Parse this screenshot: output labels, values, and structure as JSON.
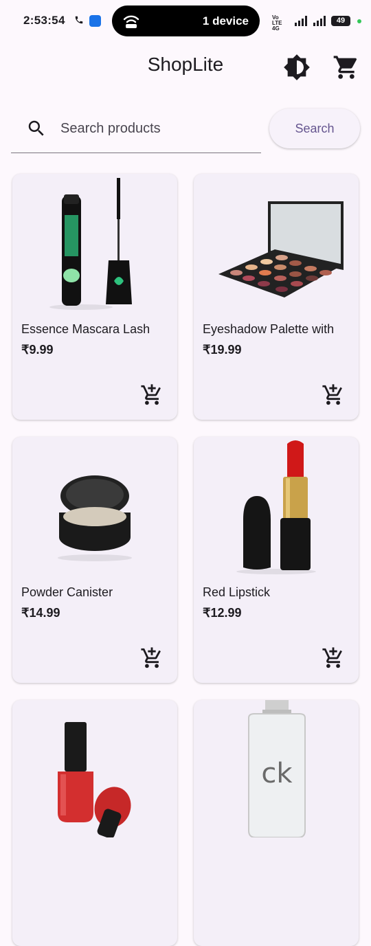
{
  "status_bar": {
    "time": "2:53:54",
    "device_pill": "1 device",
    "network": "Vo LTE 4G",
    "battery": "49"
  },
  "app_bar": {
    "title": "ShopLite",
    "theme_icon": "brightness-contrast-icon",
    "cart_icon": "shopping-cart-icon"
  },
  "search": {
    "placeholder": "Search products",
    "value": "",
    "button_label": "Search"
  },
  "products": [
    {
      "title": "Essence Mascara Lash",
      "price": "₹9.99"
    },
    {
      "title": "Eyeshadow Palette with",
      "price": "₹19.99"
    },
    {
      "title": "Powder Canister",
      "price": "₹14.99"
    },
    {
      "title": "Red Lipstick",
      "price": "₹12.99"
    },
    {
      "title": "",
      "price": ""
    },
    {
      "title": "",
      "price": ""
    }
  ],
  "colors": {
    "background": "#fdf8fd",
    "card": "#f4eff8",
    "accent": "#65558f"
  }
}
